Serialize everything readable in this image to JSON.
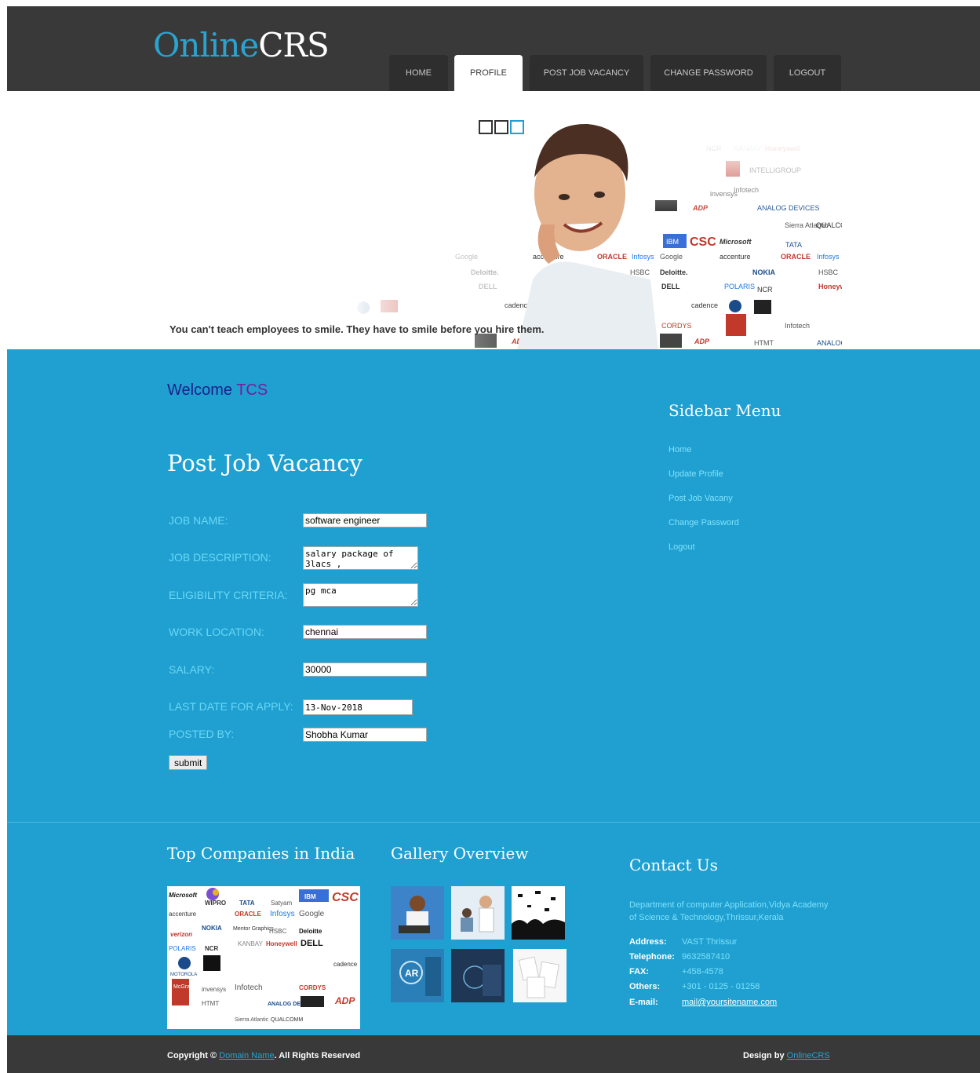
{
  "brand": {
    "part1": "Online",
    "part2": "CRS"
  },
  "nav": [
    {
      "label": "HOME"
    },
    {
      "label": "PROFILE"
    },
    {
      "label": "POST JOB VACANCY"
    },
    {
      "label": "CHANGE PASSWORD"
    },
    {
      "label": "LOGOUT"
    }
  ],
  "nav_active": "PROFILE",
  "banner": {
    "caption": "You can't teach employees to smile. They have to smile before you hire them.",
    "slides_count": 3,
    "active_slide": 3
  },
  "welcome": {
    "prefix": "Welcome",
    "name": "TCS"
  },
  "form": {
    "title": "Post Job Vacancy",
    "fields": {
      "job_name": {
        "label": "JOB NAME:",
        "value": "software engineer"
      },
      "job_description": {
        "label": "JOB DESCRIPTION:",
        "value": "salary package of 3lacs ,"
      },
      "eligibility": {
        "label": "ELIGIBILITY CRITERIA:",
        "value": "pg mca"
      },
      "location": {
        "label": "WORK LOCATION:",
        "value": "chennai"
      },
      "salary": {
        "label": "SALARY:",
        "value": "30000"
      },
      "last_date": {
        "label": "LAST DATE FOR APPLY:",
        "value": "13-Nov-2018"
      },
      "posted_by": {
        "label": "POSTED BY:",
        "value": "Shobha Kumar"
      }
    },
    "submit_label": "submit"
  },
  "sidebar": {
    "title": "Sidebar Menu",
    "items": [
      {
        "label": "Home"
      },
      {
        "label": "Update Profile"
      },
      {
        "label": "Post Job Vacany"
      },
      {
        "label": "Change Password"
      },
      {
        "label": "Logout"
      }
    ]
  },
  "footer": {
    "companies_title": "Top Companies in India",
    "companies_logos": [
      "Microsoft",
      "WIPRO",
      "TATA",
      "Satyam",
      "IBM",
      "CSC",
      "accenture",
      "ORACLE",
      "Infosys",
      "Google",
      "verizon",
      "NOKIA",
      "Mentor Graphics",
      "HSBC",
      "Deloitte",
      "POLARIS",
      "NCR",
      "KANBAY",
      "Honeywell",
      "DELL",
      "MOTOROLA",
      "cadence",
      "McGraw Hill",
      "invensys",
      "Infotech",
      "CORDYS",
      "ADP",
      "HTMT",
      "ANALOG DEVICES",
      "Sierra Atlantic",
      "QUALCOMM"
    ],
    "gallery_title": "Gallery Overview",
    "contact_title": "Contact Us",
    "contact_desc": "Department of computer Application,Vidya Academy of Science & Technology,Thrissur,Kerala",
    "contact": [
      {
        "key": "Address:",
        "value": "VAST Thrissur"
      },
      {
        "key": "Telephone:",
        "value": "9632587410"
      },
      {
        "key": "FAX:",
        "value": "+458-4578"
      },
      {
        "key": "Others:",
        "value": "+301 - 0125 - 01258"
      },
      {
        "key": "E-mail:",
        "value": "mail@yoursitename.com"
      }
    ]
  },
  "bottom": {
    "copyright_prefix": "Copyright ©",
    "domain_link": "Domain Name",
    "rights": ". All Rights Reserved",
    "design_prefix": "Design by",
    "design_link": "OnlineCRS"
  },
  "colors": {
    "header_bg": "#393939",
    "accent_blue": "#1fa0d1",
    "logo_blue": "#2aa3cf",
    "label_cyan": "#6ad7f5"
  }
}
